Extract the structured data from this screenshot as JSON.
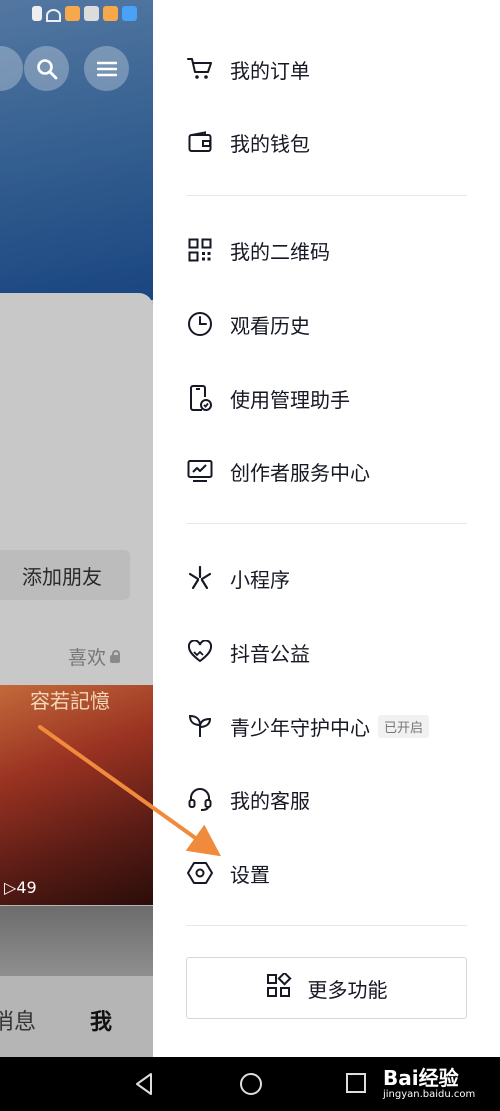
{
  "background_page": {
    "add_friend_label": "添加朋友",
    "likes_tab_label": "喜欢",
    "video_title": "容若記憶",
    "video_views": "49",
    "nav_messages": "消息",
    "nav_me": "我"
  },
  "drawer": {
    "items": [
      {
        "label": "我的订单",
        "icon": "cart-icon"
      },
      {
        "label": "我的钱包",
        "icon": "wallet-icon"
      },
      {
        "label": "我的二维码",
        "icon": "qr-code-icon"
      },
      {
        "label": "观看历史",
        "icon": "clock-icon"
      },
      {
        "label": "使用管理助手",
        "icon": "phone-manager-icon"
      },
      {
        "label": "创作者服务中心",
        "icon": "chart-monitor-icon"
      },
      {
        "label": "小程序",
        "icon": "mini-program-icon"
      },
      {
        "label": "抖音公益",
        "icon": "charity-heart-icon"
      },
      {
        "label": "青少年守护中心",
        "icon": "sprout-icon",
        "badge": "已开启"
      },
      {
        "label": "我的客服",
        "icon": "headset-icon"
      },
      {
        "label": "设置",
        "icon": "hexagon-settings-icon"
      }
    ],
    "more_button_label": "更多功能"
  },
  "watermark": {
    "brand": "Bai经验",
    "url": "jingyan.baidu.com"
  },
  "colors": {
    "arrow": "#f08a3c",
    "text": "#161823"
  }
}
